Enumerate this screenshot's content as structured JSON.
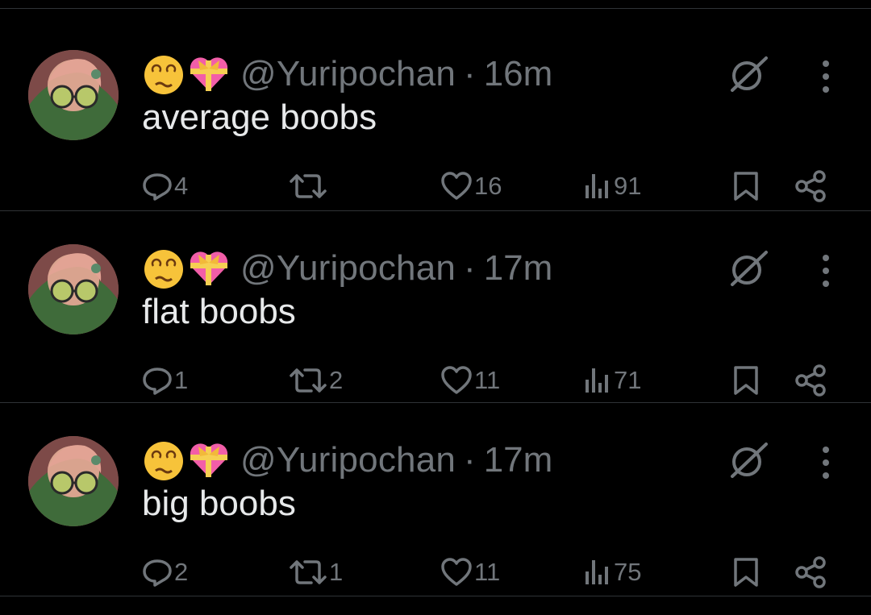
{
  "tweets": [
    {
      "handle": "@Yuripochan",
      "separator": "·",
      "time": "16m",
      "text": "average boobs",
      "replies": "4",
      "retweets": "",
      "likes": "16",
      "views": "91"
    },
    {
      "handle": "@Yuripochan",
      "separator": "·",
      "time": "17m",
      "text": "flat boobs",
      "replies": "1",
      "retweets": "2",
      "likes": "11",
      "views": "71"
    },
    {
      "handle": "@Yuripochan",
      "separator": "·",
      "time": "17m",
      "text": "big boobs",
      "replies": "2",
      "retweets": "1",
      "likes": "11",
      "views": "75"
    }
  ],
  "icons": {
    "emoji_1": "dizzy-face-emoji",
    "emoji_2": "heart-with-ribbon-emoji",
    "grok": "grok-icon",
    "more": "more-vertical-icon",
    "reply": "reply-icon",
    "retweet": "retweet-icon",
    "like": "heart-icon",
    "views": "analytics-icon",
    "bookmark": "bookmark-icon",
    "share": "share-icon"
  },
  "colors": {
    "background": "#000000",
    "text": "#e7e9ea",
    "muted": "#71767b",
    "divider": "#2f3336"
  }
}
